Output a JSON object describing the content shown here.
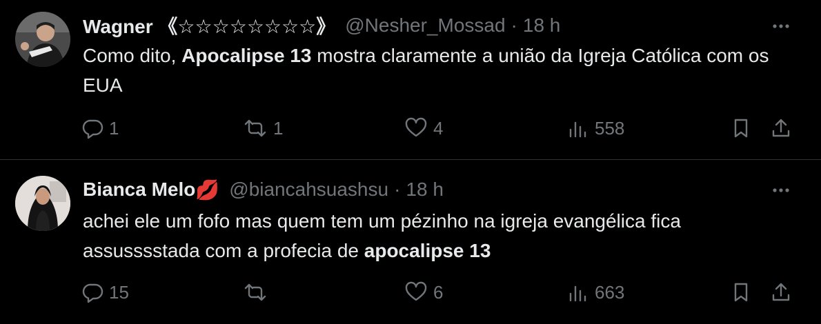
{
  "tweets": [
    {
      "display_name": "Wagner 《☆☆☆☆☆☆☆☆》",
      "handle": "@Nesher_Mossad",
      "separator": "·",
      "time": "18 h",
      "more_icon": "more-dots-icon",
      "body": {
        "part1": "Como dito, ",
        "bold1": "Apocalipse 13",
        "part2": " mostra claramente a união da Igreja Católica com os EUA"
      },
      "actions": {
        "replies": "1",
        "retweets": "1",
        "likes": "4",
        "views": "558"
      }
    },
    {
      "display_name": "Bianca Melo",
      "name_emoji": "💋",
      "handle": "@biancahsuashsu",
      "separator": "·",
      "time": "18 h",
      "more_icon": "more-dots-icon",
      "body": {
        "part1": "achei ele um fofo mas quem tem um pézinho na igreja evangélica fica assusssstada com a profecia de ",
        "bold1": "apocalipse 13"
      },
      "actions": {
        "replies": "15",
        "retweets": "",
        "likes": "6",
        "views": "663"
      }
    }
  ],
  "theme": {
    "background": "#000000",
    "text": "#e7e9ea",
    "muted": "#71767b",
    "divider": "#2f3336"
  }
}
